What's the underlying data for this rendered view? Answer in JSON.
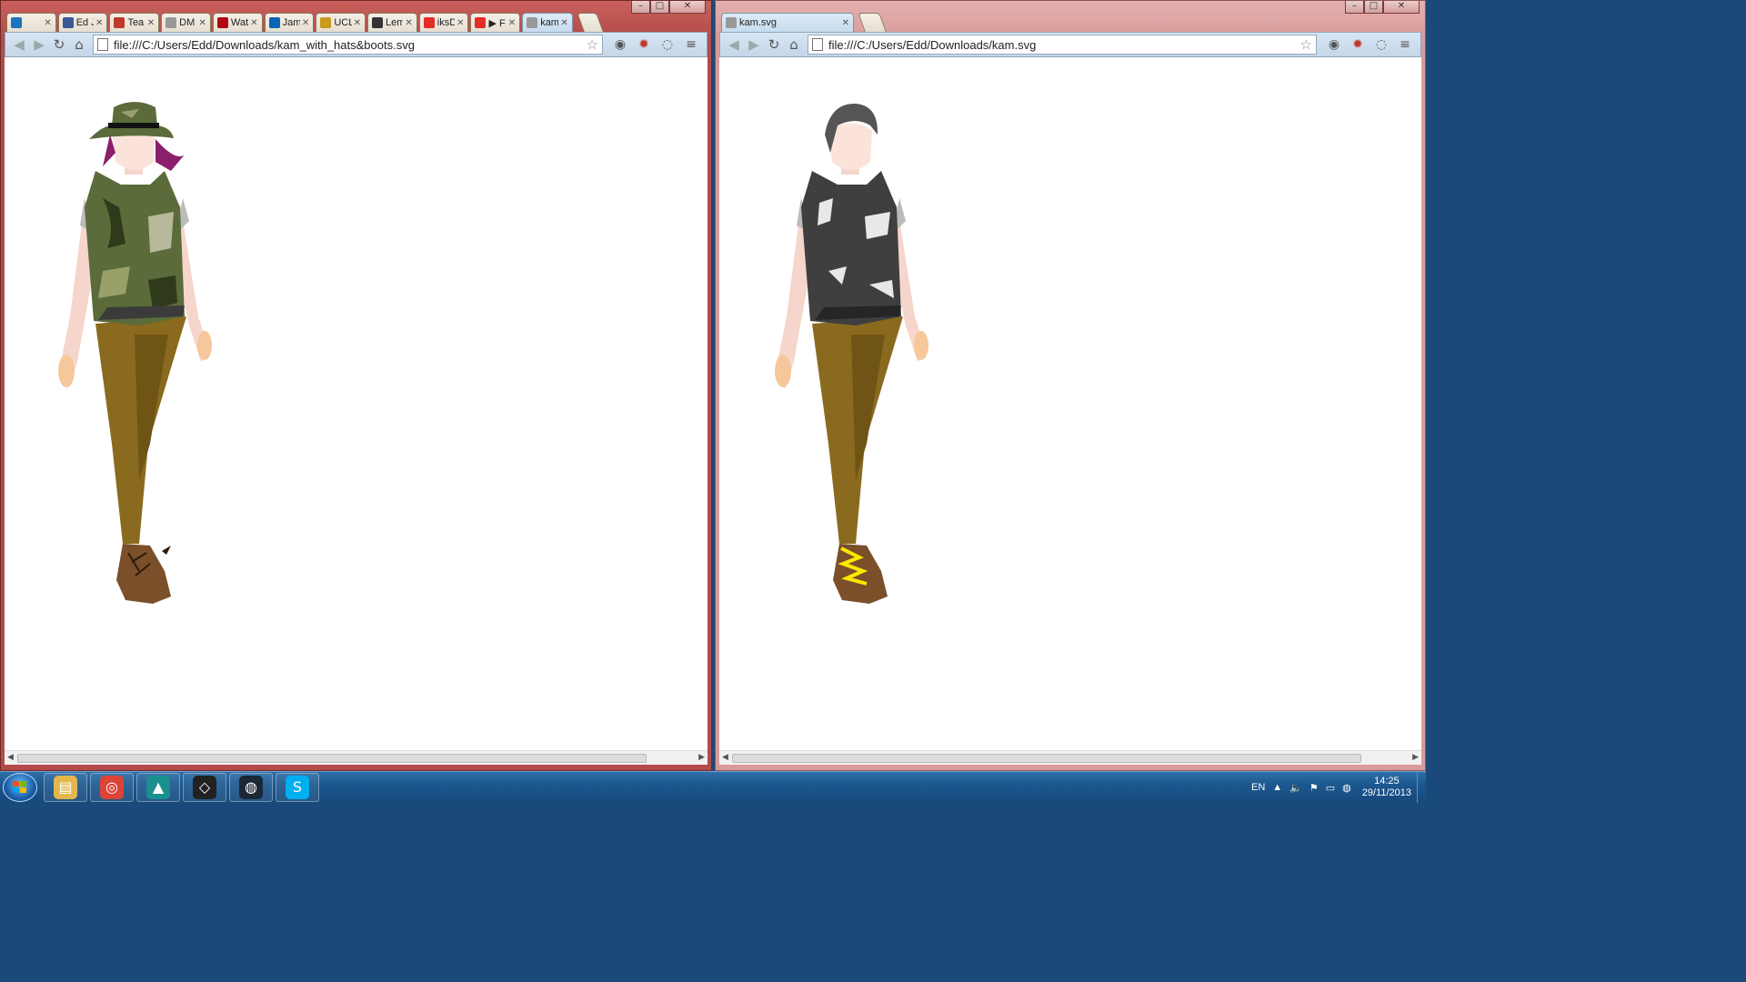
{
  "left_window": {
    "tabs": [
      {
        "label": "",
        "icon": "ie-icon",
        "color": "#1e73be"
      },
      {
        "label": "Ed J.",
        "icon": "facebook-icon",
        "color": "#3b5998"
      },
      {
        "label": "Tea",
        "icon": "flag-icon",
        "color": "#c0392b"
      },
      {
        "label": "DM",
        "icon": "page-icon",
        "color": "#999999"
      },
      {
        "label": "Wat",
        "icon": "netflix-icon",
        "color": "#b00610"
      },
      {
        "label": "Jam",
        "icon": "outlook-icon",
        "color": "#0a64b8"
      },
      {
        "label": "UCL",
        "icon": "ucl-icon",
        "color": "#c89a1e"
      },
      {
        "label": "Lem",
        "icon": "skull-icon",
        "color": "#333333"
      },
      {
        "label": "iksD",
        "icon": "youtube-icon",
        "color": "#e52d27"
      },
      {
        "label": "▶ F",
        "icon": "youtube-icon",
        "color": "#e52d27"
      },
      {
        "label": "kam",
        "icon": "page-icon",
        "color": "#999999"
      }
    ],
    "url": "file:///C:/Users/Edd/Downloads/kam_with_hats&boots.svg"
  },
  "right_window": {
    "tabs": [
      {
        "label": "kam.svg",
        "icon": "page-icon",
        "color": "#999999"
      }
    ],
    "url": "file:///C:/Users/Edd/Downloads/kam.svg"
  },
  "taskbar": {
    "apps": [
      "file-explorer-icon",
      "chrome-icon",
      "3ds-max-icon",
      "unity-icon",
      "steam-icon",
      "skype-icon"
    ],
    "language": "EN",
    "time": "14:25",
    "date": "29/11/2013"
  },
  "caption": {
    "minimize": "–",
    "maximize": "□",
    "close": "✕"
  },
  "colors": {
    "camo_green": "#5b6b3a",
    "vest_grey": "#3f3f3f",
    "trousers": "#8a6a1e",
    "laces": "#ffe800"
  }
}
